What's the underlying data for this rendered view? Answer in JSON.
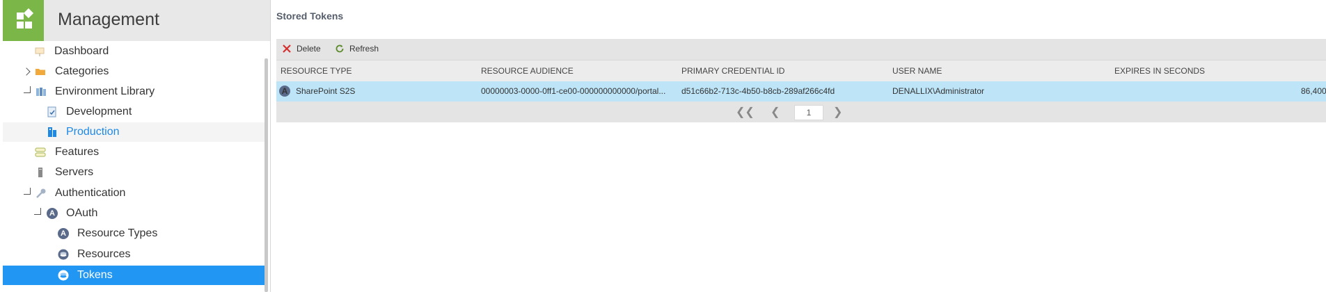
{
  "app": {
    "title": "Management"
  },
  "sidebar": {
    "items": [
      {
        "label": "Dashboard",
        "icon": "dashboard-icon"
      },
      {
        "label": "Categories",
        "icon": "folder-icon"
      },
      {
        "label": "Environment Library",
        "icon": "library-icon"
      },
      {
        "label": "Development",
        "icon": "development-icon"
      },
      {
        "label": "Production",
        "icon": "production-icon"
      },
      {
        "label": "Features",
        "icon": "features-icon"
      },
      {
        "label": "Servers",
        "icon": "server-icon"
      },
      {
        "label": "Authentication",
        "icon": "key-icon"
      },
      {
        "label": "OAuth",
        "icon": "oauth-icon"
      },
      {
        "label": "Resource Types",
        "icon": "resource-type-icon"
      },
      {
        "label": "Resources",
        "icon": "resources-icon"
      },
      {
        "label": "Tokens",
        "icon": "tokens-icon"
      }
    ]
  },
  "main": {
    "title": "Stored Tokens",
    "toolbar": {
      "delete_label": "Delete",
      "refresh_label": "Refresh"
    },
    "columns": [
      "RESOURCE TYPE",
      "RESOURCE AUDIENCE",
      "PRIMARY CREDENTIAL ID",
      "USER NAME",
      "EXPIRES IN SECONDS"
    ],
    "rows": [
      {
        "resource_type": "SharePoint S2S",
        "resource_audience": "00000003-0000-0ff1-ce00-000000000000/portal...",
        "primary_credential_id": "d51c66b2-713c-4b50-b8cb-289af266c4fd",
        "user_name": "DENALLIX\\Administrator",
        "expires_in_seconds": "86,400"
      }
    ],
    "pager": {
      "page": "1"
    }
  },
  "colors": {
    "accent": "#2196f3",
    "brand": "#7ab648",
    "row_selected": "#bde4f7"
  }
}
